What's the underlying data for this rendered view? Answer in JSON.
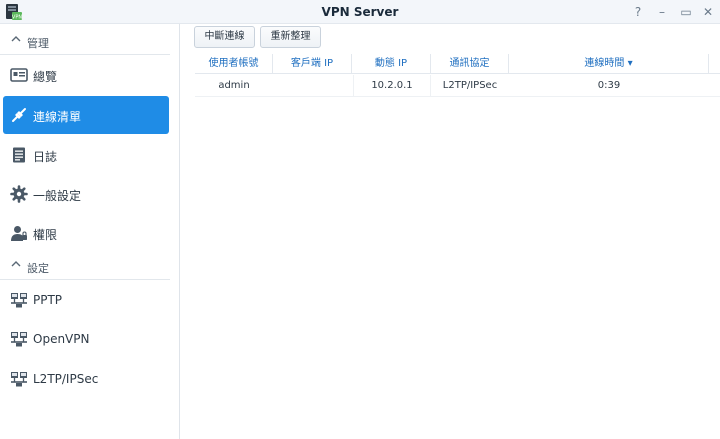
{
  "window": {
    "title": "VPN Server",
    "controls": [
      "?",
      "–",
      "▭",
      "✕"
    ]
  },
  "sidebar": {
    "groups": [
      {
        "label": "管理",
        "items": [
          {
            "label": "總覽",
            "icon": "overview-icon",
            "active": false
          },
          {
            "label": "連線清單",
            "icon": "connection-list-icon",
            "active": true
          },
          {
            "label": "日誌",
            "icon": "log-icon",
            "active": false
          },
          {
            "label": "一般設定",
            "icon": "gear-icon",
            "active": false
          },
          {
            "label": "權限",
            "icon": "user-permission-icon",
            "active": false
          }
        ]
      },
      {
        "label": "設定",
        "items": [
          {
            "label": "PPTP",
            "icon": "network-icon",
            "active": false
          },
          {
            "label": "OpenVPN",
            "icon": "network-icon",
            "active": false
          },
          {
            "label": "L2TP/IPSec",
            "icon": "network-icon",
            "active": false
          }
        ]
      }
    ]
  },
  "toolbar": {
    "disconnect_label": "中斷連線",
    "refresh_label": "重新整理"
  },
  "table": {
    "columns": [
      "使用者帳號",
      "客戶端 IP",
      "動態 IP",
      "通訊協定",
      "連線時間"
    ],
    "sort_indicator": "▾",
    "rows": [
      {
        "user": "admin",
        "client_ip": "",
        "dynamic_ip": "10.2.0.1",
        "protocol": "L2TP/IPSec",
        "uptime": "0:39"
      }
    ]
  },
  "colors": {
    "accent": "#1f8ce6",
    "header_text": "#1f6fc0",
    "app_icon_bg": "#2b3640",
    "app_icon_badge": "#5cb85c"
  }
}
